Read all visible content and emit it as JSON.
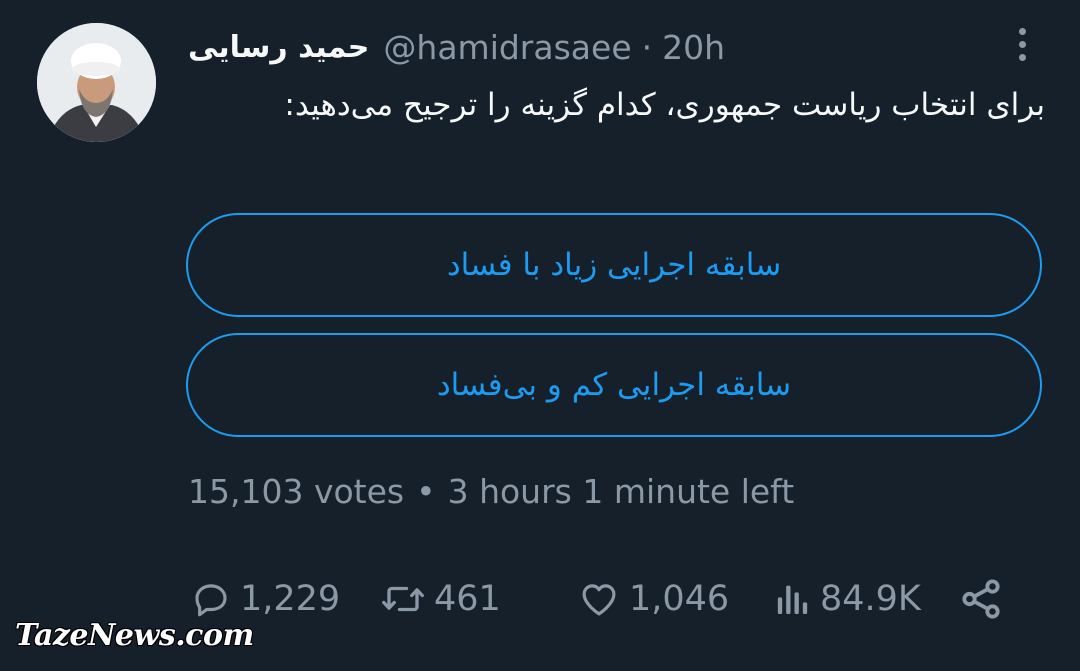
{
  "tweet": {
    "author_name": "حمید رسایی",
    "handle": "@hamidrasaee",
    "separator": "·",
    "time": "20h",
    "text": "برای انتخاب ریاست جمهوری، کدام گزینه را ترجیح می‌دهید:"
  },
  "poll": {
    "options": [
      "سابقه اجرایی زیاد با فساد",
      "سابقه اجرایی کم و بی‌فساد"
    ],
    "votes": "15,103 votes",
    "separator": "•",
    "time_left": "3 hours 1 minute left"
  },
  "actions": {
    "replies": "1,229",
    "retweets": "461",
    "likes": "1,046",
    "views": "84.9K"
  },
  "icons": {
    "reply": "reply-icon",
    "retweet": "retweet-icon",
    "like": "heart-icon",
    "views": "views-icon",
    "share": "share-icon",
    "more": "more-vertical-icon"
  },
  "watermark": "TazeNews.com",
  "colors": {
    "background": "#15202b",
    "accent": "#1d9bf0",
    "secondary_text": "#8b98a5",
    "primary_text": "#f7f9f9"
  }
}
